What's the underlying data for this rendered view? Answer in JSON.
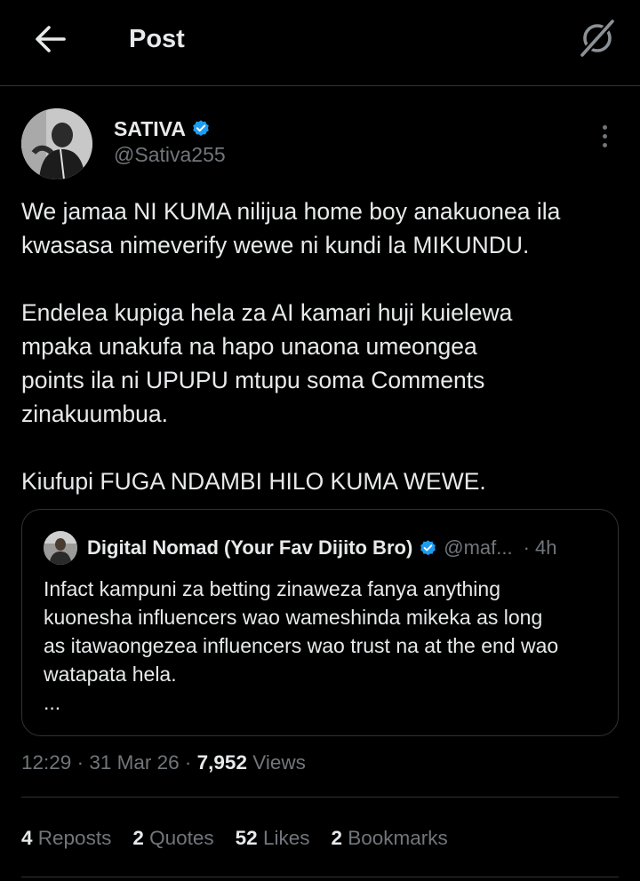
{
  "header": {
    "back_icon": "arrow-left-icon",
    "title": "Post",
    "grok_icon": "grok-icon"
  },
  "author": {
    "name": "SATIVA",
    "handle": "@Sativa255",
    "verified": true,
    "verified_color": "#1d9bf0"
  },
  "tweet": {
    "paragraphs": [
      [
        "We jamaa NI KUMA nilijua home boy anakuonea ila",
        "kwasasa nimeverify wewe ni kundi la MIKUNDU."
      ],
      [
        "Endelea kupiga hela za AI kamari huji kuielewa",
        "mpaka unakufa na hapo unaona umeongea",
        "points ila ni UPUPU mtupu soma Comments",
        "zinakuumbua."
      ],
      [
        "Kiufupi FUGA NDAMBI HILO KUMA WEWE."
      ]
    ]
  },
  "quote": {
    "name": "Digital Nomad (Your Fav Dijito Bro)",
    "handle": "@maf...",
    "time": "· 4h",
    "lines": [
      "Infact kampuni za betting zinaweza fanya anything",
      "kuonesha influencers wao wameshinda mikeka as long",
      "as itawaongezea influencers wao trust na at the end wao",
      "watapata hela.",
      "..."
    ]
  },
  "meta": {
    "time": "12:29",
    "date": "31 Mar 26",
    "views_count": "7,952",
    "views_label": "Views"
  },
  "stats": {
    "reposts": {
      "count": "4",
      "label": "Reposts"
    },
    "quotes": {
      "count": "2",
      "label": "Quotes"
    },
    "likes": {
      "count": "52",
      "label": "Likes"
    },
    "bookmarks": {
      "count": "2",
      "label": "Bookmarks"
    }
  },
  "colors": {
    "background": "#000000",
    "text": "#e7e9ea",
    "secondary": "#71767b",
    "border": "#2f3336",
    "accent": "#1d9bf0"
  }
}
